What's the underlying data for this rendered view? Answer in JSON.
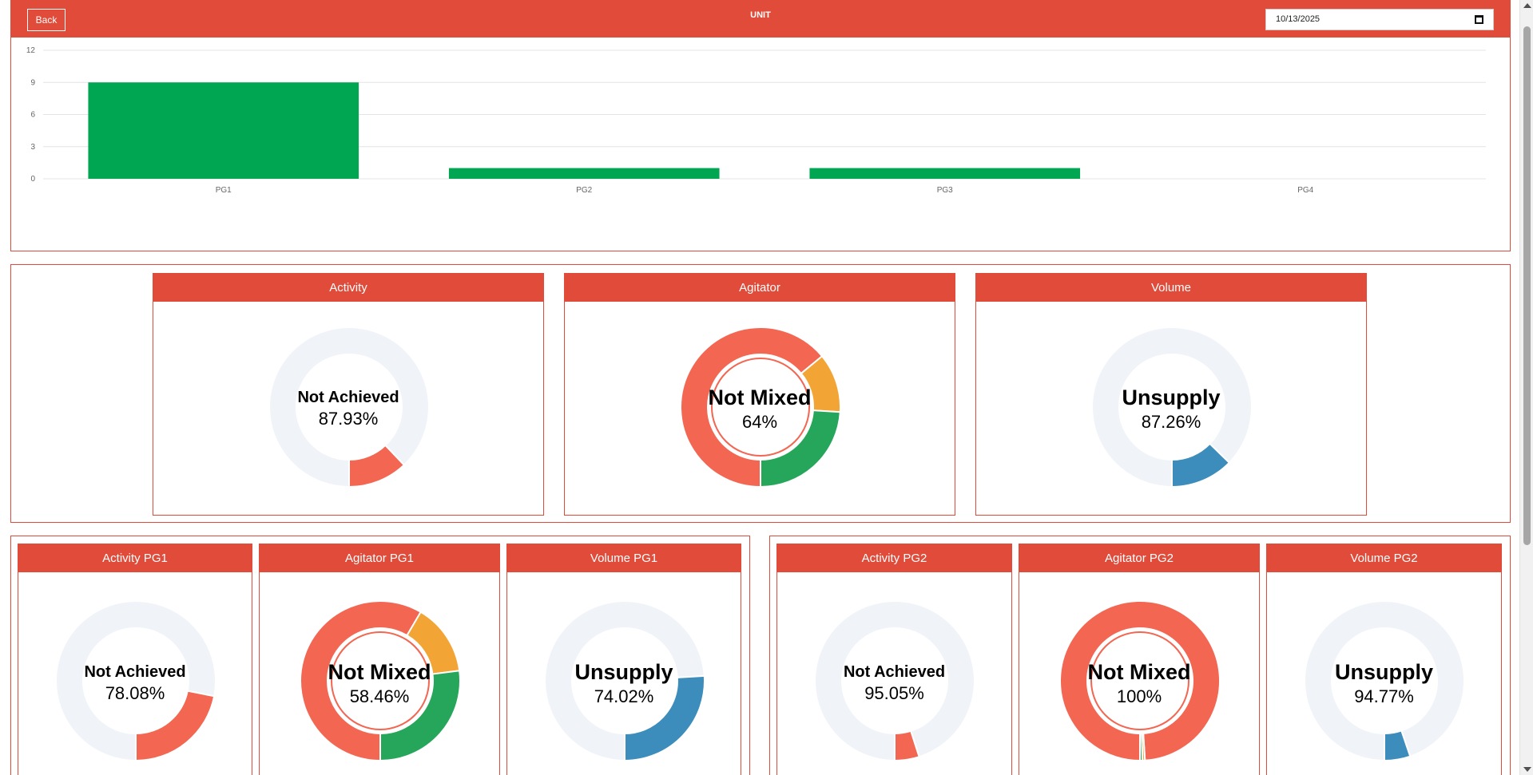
{
  "header": {
    "back_label": "Back",
    "title": "UNIT",
    "date_value": "10/13/2025",
    "accent_color": "#e04b3a",
    "calendar_icon": "calendar-icon"
  },
  "chart_data": {
    "type": "bar",
    "categories": [
      "PG1",
      "PG2",
      "PG3",
      "PG4"
    ],
    "values": [
      9,
      1,
      1,
      0
    ],
    "title": "",
    "xlabel": "",
    "ylabel": "",
    "ylim": [
      0,
      12
    ],
    "yticks": [
      0,
      3,
      6,
      9,
      12
    ],
    "grid": true,
    "color": "#00a651"
  },
  "summary": {
    "activity": {
      "title": "Activity",
      "label": "Not Achieved",
      "value": "87.93%"
    },
    "agitator": {
      "title": "Agitator",
      "label": "Not Mixed",
      "value": "64%"
    },
    "volume": {
      "title": "Volume",
      "label": "Unsupply",
      "value": "87.26%"
    }
  },
  "pg1": {
    "activity": {
      "title": "Activity PG1",
      "label": "Not Achieved",
      "value": "78.08%"
    },
    "agitator": {
      "title": "Agitator PG1",
      "label": "Not Mixed",
      "value": "58.46%"
    },
    "volume": {
      "title": "Volume PG1",
      "label": "Unsupply",
      "value": "74.02%"
    }
  },
  "pg2": {
    "activity": {
      "title": "Activity PG2",
      "label": "Not Achieved",
      "value": "95.05%"
    },
    "agitator": {
      "title": "Agitator PG2",
      "label": "Not Mixed",
      "value": "100%"
    },
    "volume": {
      "title": "Volume PG2",
      "label": "Unsupply",
      "value": "94.77%"
    }
  },
  "donuts": [
    {
      "id": "d-act",
      "segments": [
        {
          "value": 87.93,
          "color": "#f0f3f8"
        },
        {
          "value": 12.07,
          "color": "#f26652"
        }
      ]
    },
    {
      "id": "d-agi",
      "segments": [
        {
          "value": 64,
          "color": "#f26652"
        },
        {
          "value": 12,
          "color": "#f2a534"
        },
        {
          "value": 24,
          "color": "#26a65b"
        }
      ],
      "inner_ring": "#f26652"
    },
    {
      "id": "d-vol",
      "segments": [
        {
          "value": 87.26,
          "color": "#f0f3f8"
        },
        {
          "value": 12.74,
          "color": "#3c8dbc"
        }
      ]
    },
    {
      "id": "d-act-pg1",
      "segments": [
        {
          "value": 78.08,
          "color": "#f0f3f8"
        },
        {
          "value": 21.92,
          "color": "#f26652"
        }
      ]
    },
    {
      "id": "d-agi-pg1",
      "segments": [
        {
          "value": 58.46,
          "color": "#f26652"
        },
        {
          "value": 14.5,
          "color": "#f2a534"
        },
        {
          "value": 27.04,
          "color": "#26a65b"
        }
      ],
      "inner_ring": "#f26652"
    },
    {
      "id": "d-vol-pg1",
      "segments": [
        {
          "value": 74.02,
          "color": "#f0f3f8"
        },
        {
          "value": 25.98,
          "color": "#3c8dbc"
        }
      ]
    },
    {
      "id": "d-act-pg2",
      "segments": [
        {
          "value": 95.05,
          "color": "#f0f3f8"
        },
        {
          "value": 4.95,
          "color": "#f26652"
        }
      ]
    },
    {
      "id": "d-agi-pg2",
      "segments": [
        {
          "value": 99,
          "color": "#f26652"
        },
        {
          "value": 0.5,
          "color": "#f2a534"
        },
        {
          "value": 0.5,
          "color": "#26a65b"
        }
      ],
      "inner_ring": "#f26652"
    },
    {
      "id": "d-vol-pg2",
      "segments": [
        {
          "value": 94.77,
          "color": "#f0f3f8"
        },
        {
          "value": 5.23,
          "color": "#3c8dbc"
        }
      ]
    }
  ]
}
